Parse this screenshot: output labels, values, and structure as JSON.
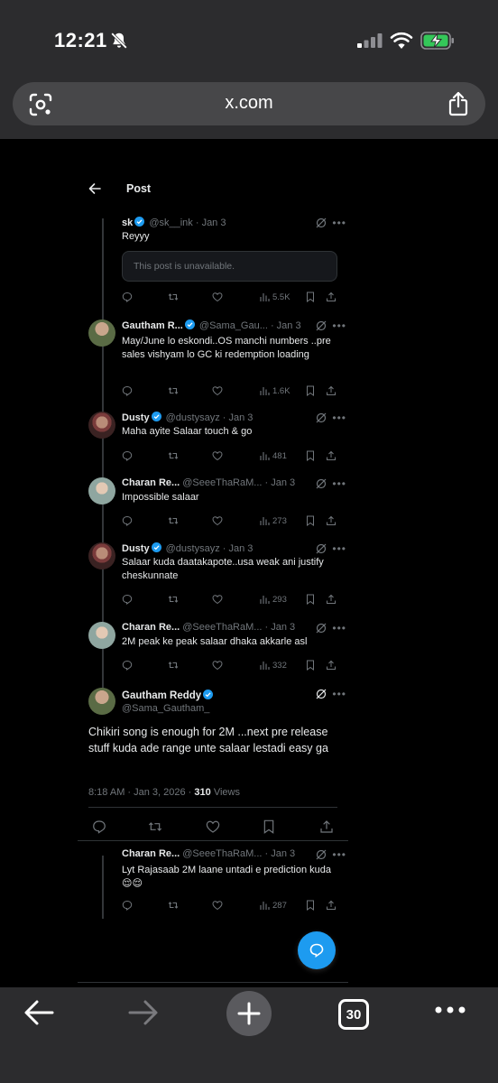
{
  "status_bar": {
    "time": "12:21"
  },
  "browser": {
    "url": "x.com",
    "tab_count": "30"
  },
  "post_header": {
    "title": "Post"
  },
  "tweets": [
    {
      "name": "sk",
      "handle": "@sk__ink",
      "date": "· Jan 3",
      "text": "Reyyy",
      "unavailable": "This post is unavailable.",
      "views": "5.5K"
    },
    {
      "name": "Gautham R...",
      "handle": "@Sama_Gau...",
      "date": "· Jan 3",
      "text": "May/June lo eskondi..OS manchi  numbers ..pre sales vishyam lo GC ki redemption loading",
      "views": "1.6K"
    },
    {
      "name": "Dusty",
      "handle": "@dustysayz",
      "date": "· Jan 3",
      "text": "Maha ayite Salaar touch & go",
      "views": "481"
    },
    {
      "name": "Charan Re...",
      "handle": "@SeeeThaRaM...",
      "date": "· Jan 3",
      "text": "Impossible salaar",
      "views": "273"
    },
    {
      "name": "Dusty",
      "handle": "@dustysayz",
      "date": "· Jan 3",
      "text": "Salaar kuda daatakapote..usa weak ani justify cheskunnate",
      "views": "293"
    },
    {
      "name": "Charan Re...",
      "handle": "@SeeeThaRaM...",
      "date": "· Jan 3",
      "text": "2M peak ke peak salaar dhaka akkarle asl",
      "views": "332"
    }
  ],
  "focused_tweet": {
    "name": "Gautham Reddy",
    "handle": "@Sama_Gautham_",
    "text": "Chikiri song is enough for 2M ...next pre release stuff kuda ade range unte salaar lestadi easy ga",
    "timestamp": "8:18 AM · Jan 3, 2026 · ",
    "views_count": "310",
    "views_label": " Views"
  },
  "reply": {
    "name": "Charan Re...",
    "handle": "@SeeeThaRaM...",
    "date": "· Jan 3",
    "text": "Lyt Rajasaab 2M laane untadi e prediction kuda😌😌",
    "views": "287"
  },
  "colors": {
    "accent": "#1d9bf0",
    "background": "#000000",
    "secondary_text": "#71767b"
  }
}
